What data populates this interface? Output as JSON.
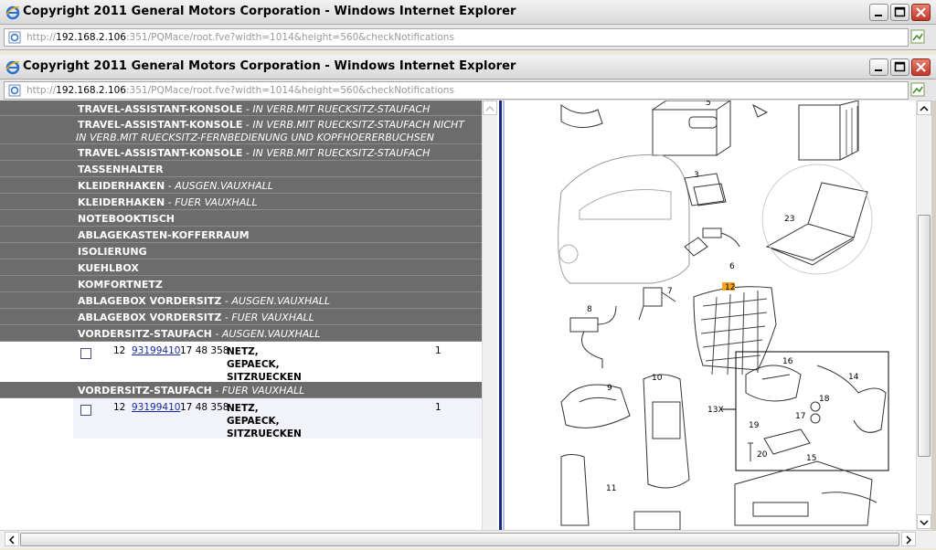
{
  "windows": [
    {
      "title": "Copyright 2011 General Motors Corporation - Windows Internet Explorer",
      "url_pre": "http://",
      "url_host": "192.168.2.106",
      "url_post": ":351/PQMace/root.fve?width=1014&height=560&checkNotifications"
    },
    {
      "title": "Copyright 2011 General Motors Corporation - Windows Internet Explorer",
      "url_pre": "http://",
      "url_host": "192.168.2.106",
      "url_post": ":351/PQMace/root.fve?width=1014&height=560&checkNotifications"
    }
  ],
  "categories": [
    {
      "name": "TRAVEL-ASSISTANT-KONSOLE",
      "sep": " - ",
      "desc": "IN VERB.MIT RUECKSITZ-STAUFACH"
    },
    {
      "name": "TRAVEL-ASSISTANT-KONSOLE",
      "sep": " - ",
      "desc": "IN VERB.MIT RUECKSITZ-STAUFACH NICHT IN VERB.MIT RUECKSITZ-FERNBEDIENUNG UND KOPFHOERERBUCHSEN"
    },
    {
      "name": "TRAVEL-ASSISTANT-KONSOLE",
      "sep": " - ",
      "desc": "IN VERB.MIT RUECKSITZ-STAUFACH"
    },
    {
      "name": "TASSENHALTER",
      "sep": "",
      "desc": ""
    },
    {
      "name": "KLEIDERHAKEN",
      "sep": " - ",
      "desc": "AUSGEN.VAUXHALL"
    },
    {
      "name": "KLEIDERHAKEN",
      "sep": " - ",
      "desc": "FUER VAUXHALL"
    },
    {
      "name": "NOTEBOOKTISCH",
      "sep": "",
      "desc": ""
    },
    {
      "name": "ABLAGEKASTEN-KOFFERRAUM",
      "sep": "",
      "desc": ""
    },
    {
      "name": "ISOLIERUNG",
      "sep": "",
      "desc": ""
    },
    {
      "name": "KUEHLBOX",
      "sep": "",
      "desc": ""
    },
    {
      "name": "KOMFORTNETZ",
      "sep": "",
      "desc": ""
    },
    {
      "name": "ABLAGEBOX VORDERSITZ",
      "sep": " - ",
      "desc": "AUSGEN.VAUXHALL"
    },
    {
      "name": "ABLAGEBOX VORDERSITZ",
      "sep": " - ",
      "desc": "FUER VAUXHALL"
    },
    {
      "name": "VORDERSITZ-STAUFACH",
      "sep": " - ",
      "desc": "AUSGEN.VAUXHALL"
    },
    {
      "name": "VORDERSITZ-STAUFACH",
      "sep": " - ",
      "desc": "FUER VAUXHALL"
    }
  ],
  "parts": [
    {
      "pos": "12",
      "part_no": "93199410",
      "catalog": "17 48 358",
      "desc": "NETZ,\nGEPAECK,\nSITZRUECKEN",
      "qty": "1"
    },
    {
      "pos": "12",
      "part_no": "93199410",
      "catalog": "17 48 358",
      "desc": "NETZ,\nGEPAECK,\nSITZRUECKEN",
      "qty": "1"
    }
  ],
  "diagram": {
    "callouts": [
      "5",
      "3",
      "23",
      "6",
      "12",
      "7",
      "8",
      "9",
      "10",
      "16",
      "14",
      "13X",
      "18",
      "17",
      "19",
      "20",
      "15",
      "11"
    ],
    "highlight_color": "#f5a623"
  },
  "colors": {
    "row_bg": "#6c6c6c",
    "link": "#1a2aa8",
    "divider": "#1b2a8a"
  }
}
